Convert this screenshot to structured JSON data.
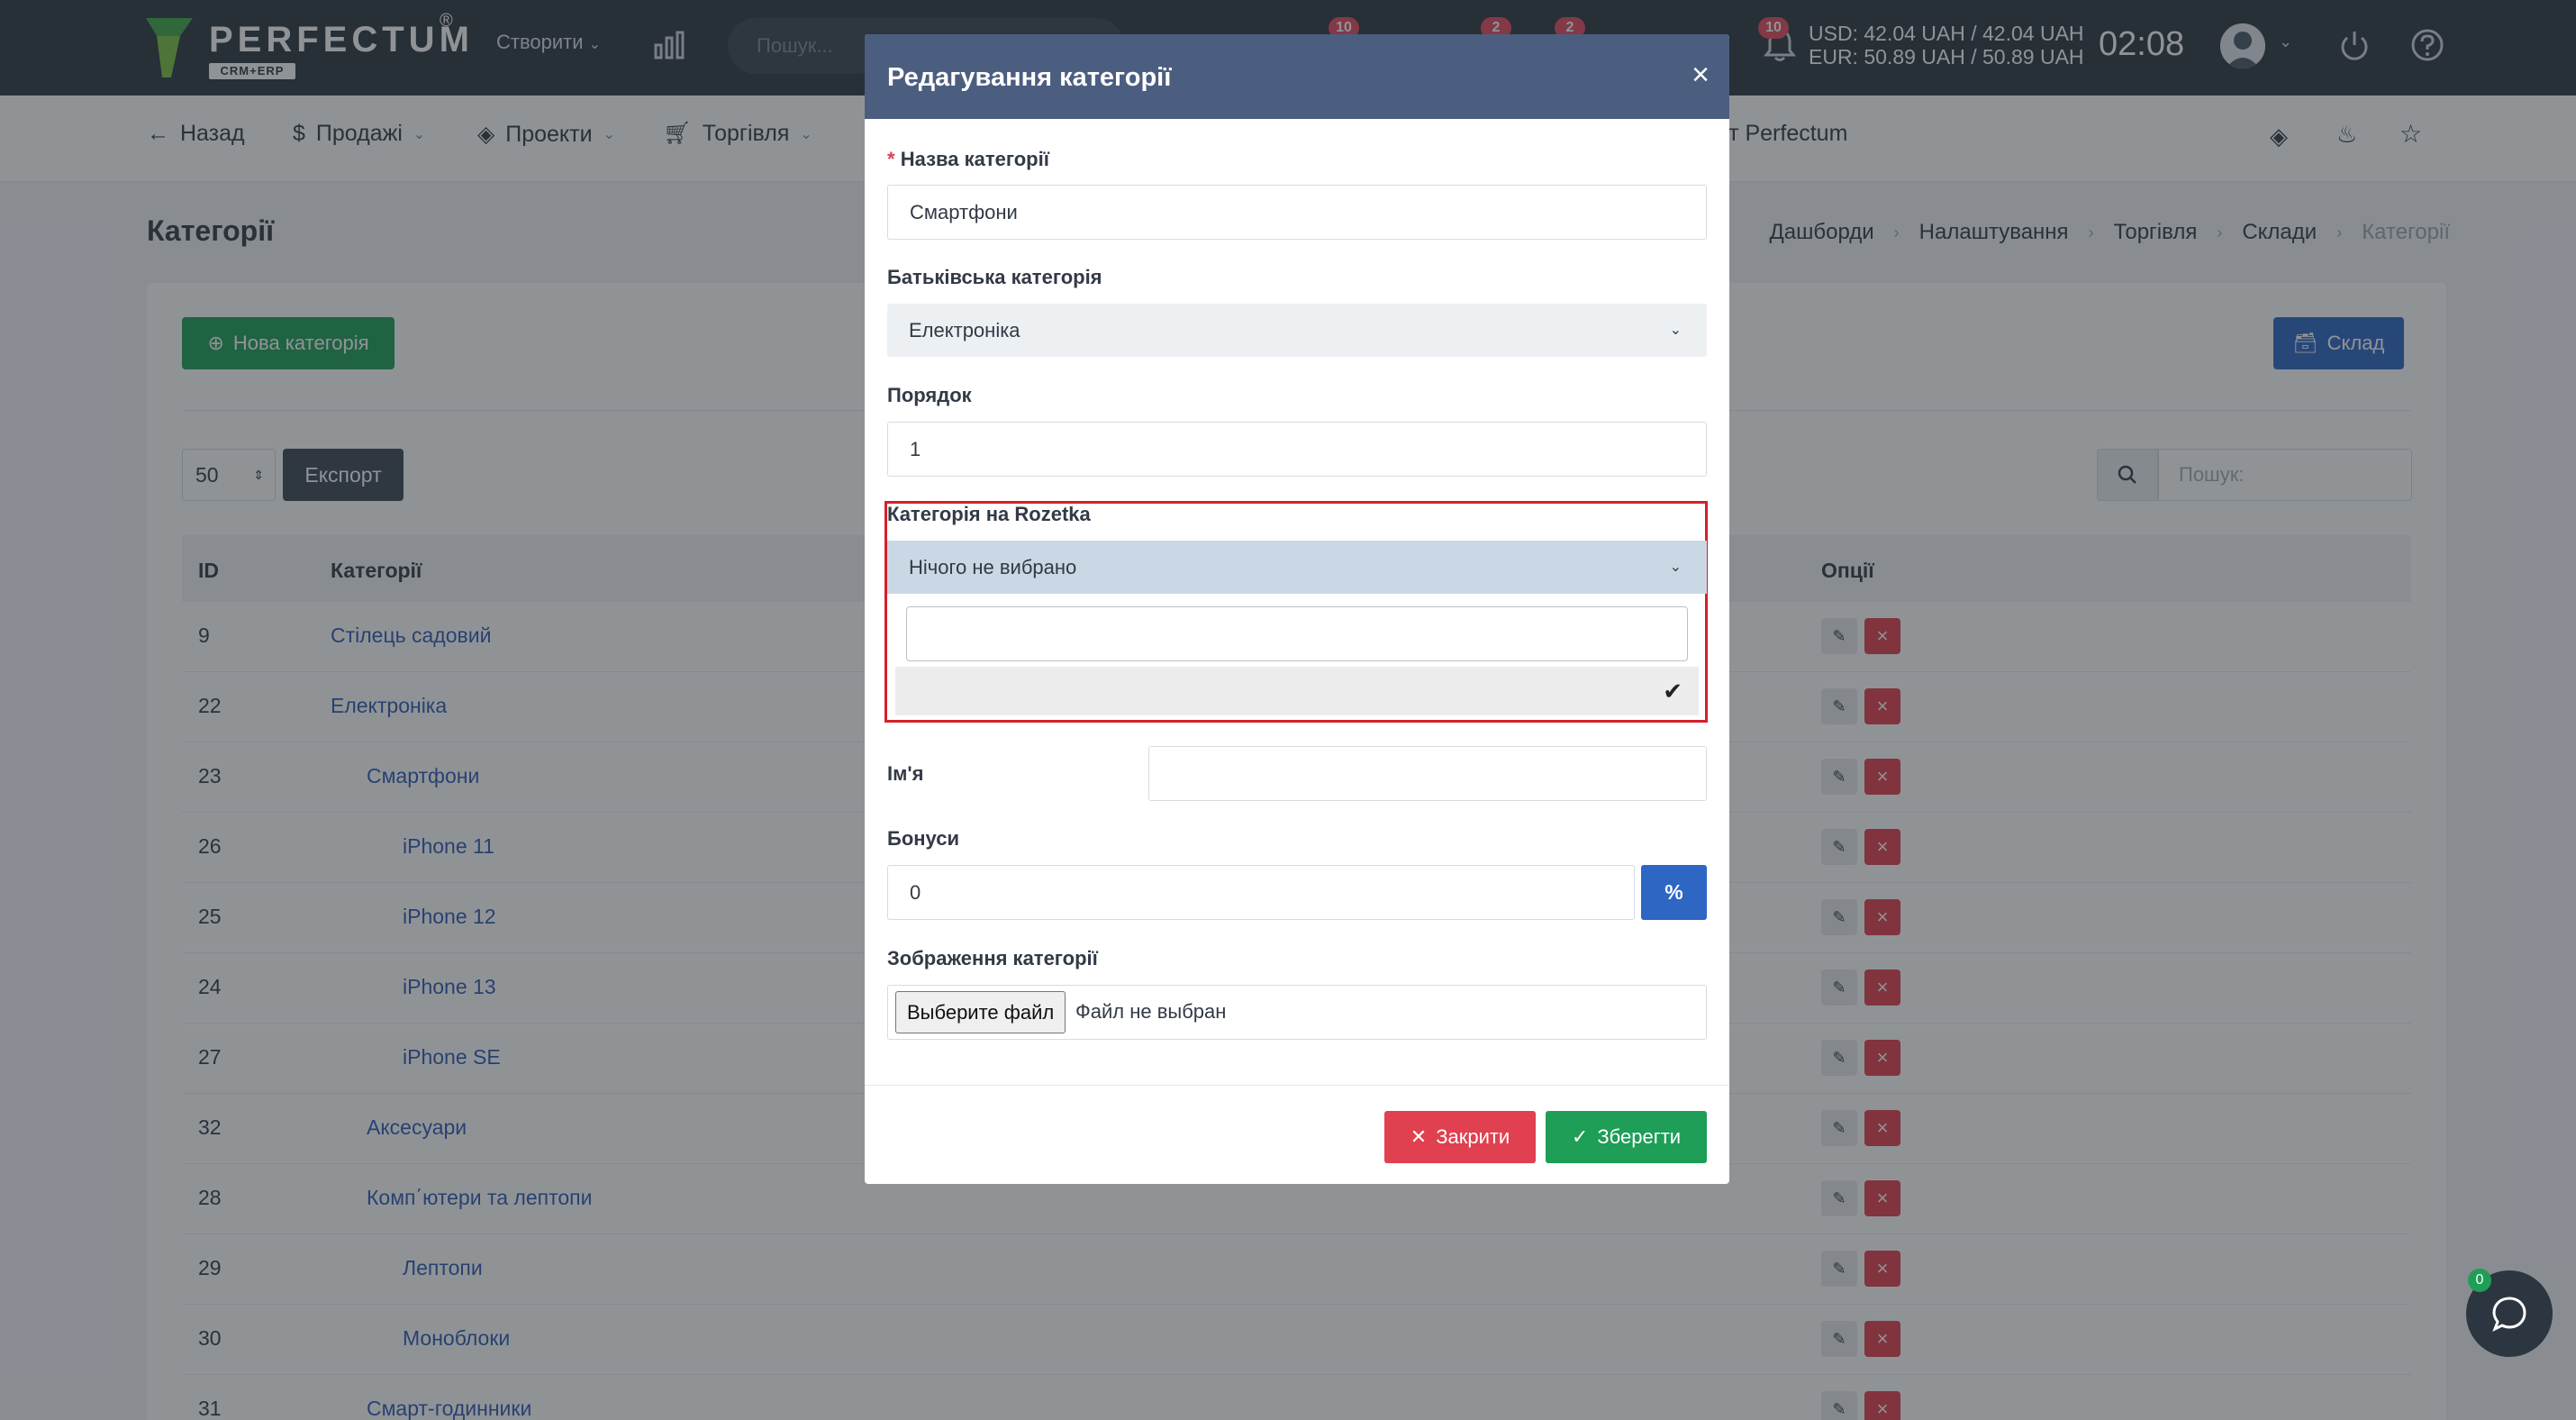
{
  "topbar": {
    "logo_text": "PERFECTUM",
    "logo_reg": "®",
    "logo_sub": "CRM+ERP",
    "create_label": "Створити",
    "search_placeholder": "Пошук...",
    "badges": [
      "10",
      "2",
      "2",
      "10"
    ],
    "rate_usd": "USD: 42.04 UAH / 42.04 UAH",
    "rate_eur": "EUR: 50.89 UAH / 50.89 UAH",
    "time": "02:08"
  },
  "subnav": {
    "back": "Назад",
    "sales": "Продажі",
    "projects": "Проекти",
    "trade": "Торгівля",
    "perfectum": "ет Perfectum"
  },
  "page": {
    "title": "Категорії",
    "breadcrumbs": [
      "Дашборди",
      "Налаштування",
      "Торгівля",
      "Склади",
      "Категорії"
    ]
  },
  "toolbar": {
    "new_category": "Нова категорія",
    "store": "Склад",
    "page_size": "50",
    "export": "Експорт",
    "search_placeholder": "Пошук:"
  },
  "table": {
    "headers": {
      "id": "ID",
      "name": "Категорії",
      "options": "Опції"
    },
    "rows": [
      {
        "id": "9",
        "name": "Стілець садовий"
      },
      {
        "id": "22",
        "name": "Електроніка"
      },
      {
        "id": "23",
        "name": "Смартфони"
      },
      {
        "id": "26",
        "name": "iPhone 11"
      },
      {
        "id": "25",
        "name": "iPhone 12"
      },
      {
        "id": "24",
        "name": "iPhone 13"
      },
      {
        "id": "27",
        "name": "iPhone SE"
      },
      {
        "id": "32",
        "name": "Аксесуари"
      },
      {
        "id": "28",
        "name": "Комп΄ютери та лептопи"
      },
      {
        "id": "29",
        "name": "Лептопи"
      },
      {
        "id": "30",
        "name": "Моноблоки"
      },
      {
        "id": "31",
        "name": "Смарт-годинники"
      }
    ]
  },
  "modal": {
    "title": "Редагування категорії",
    "close_x": "×",
    "name_label": "Назва категорії",
    "required_mark": "*",
    "name_value": "Смартфони",
    "parent_label": "Батьківська категорія",
    "parent_value": "Електроніка",
    "order_label": "Порядок",
    "order_value": "1",
    "rozetka_label": "Категорія на Rozetka",
    "rozetka_value": "Нічого не вибрано",
    "rozetka_search_value": "",
    "name2_label": "Ім'я",
    "name2_value": "",
    "bonus_label": "Бонуси",
    "bonus_value": "0",
    "bonus_unit": "%",
    "image_label": "Зображення категорії",
    "file_button": "Выберите файл",
    "file_status": "Файл не выбран",
    "close_button": "Закрити",
    "save_button": "Зберегти"
  },
  "chat": {
    "badge": "0"
  },
  "colors": {
    "topbar": "#2c3640",
    "modal_header": "#4b5e80",
    "primary": "#2e66c4",
    "success": "#1e9e57",
    "danger": "#e0404f",
    "highlight": "#d5202a"
  }
}
